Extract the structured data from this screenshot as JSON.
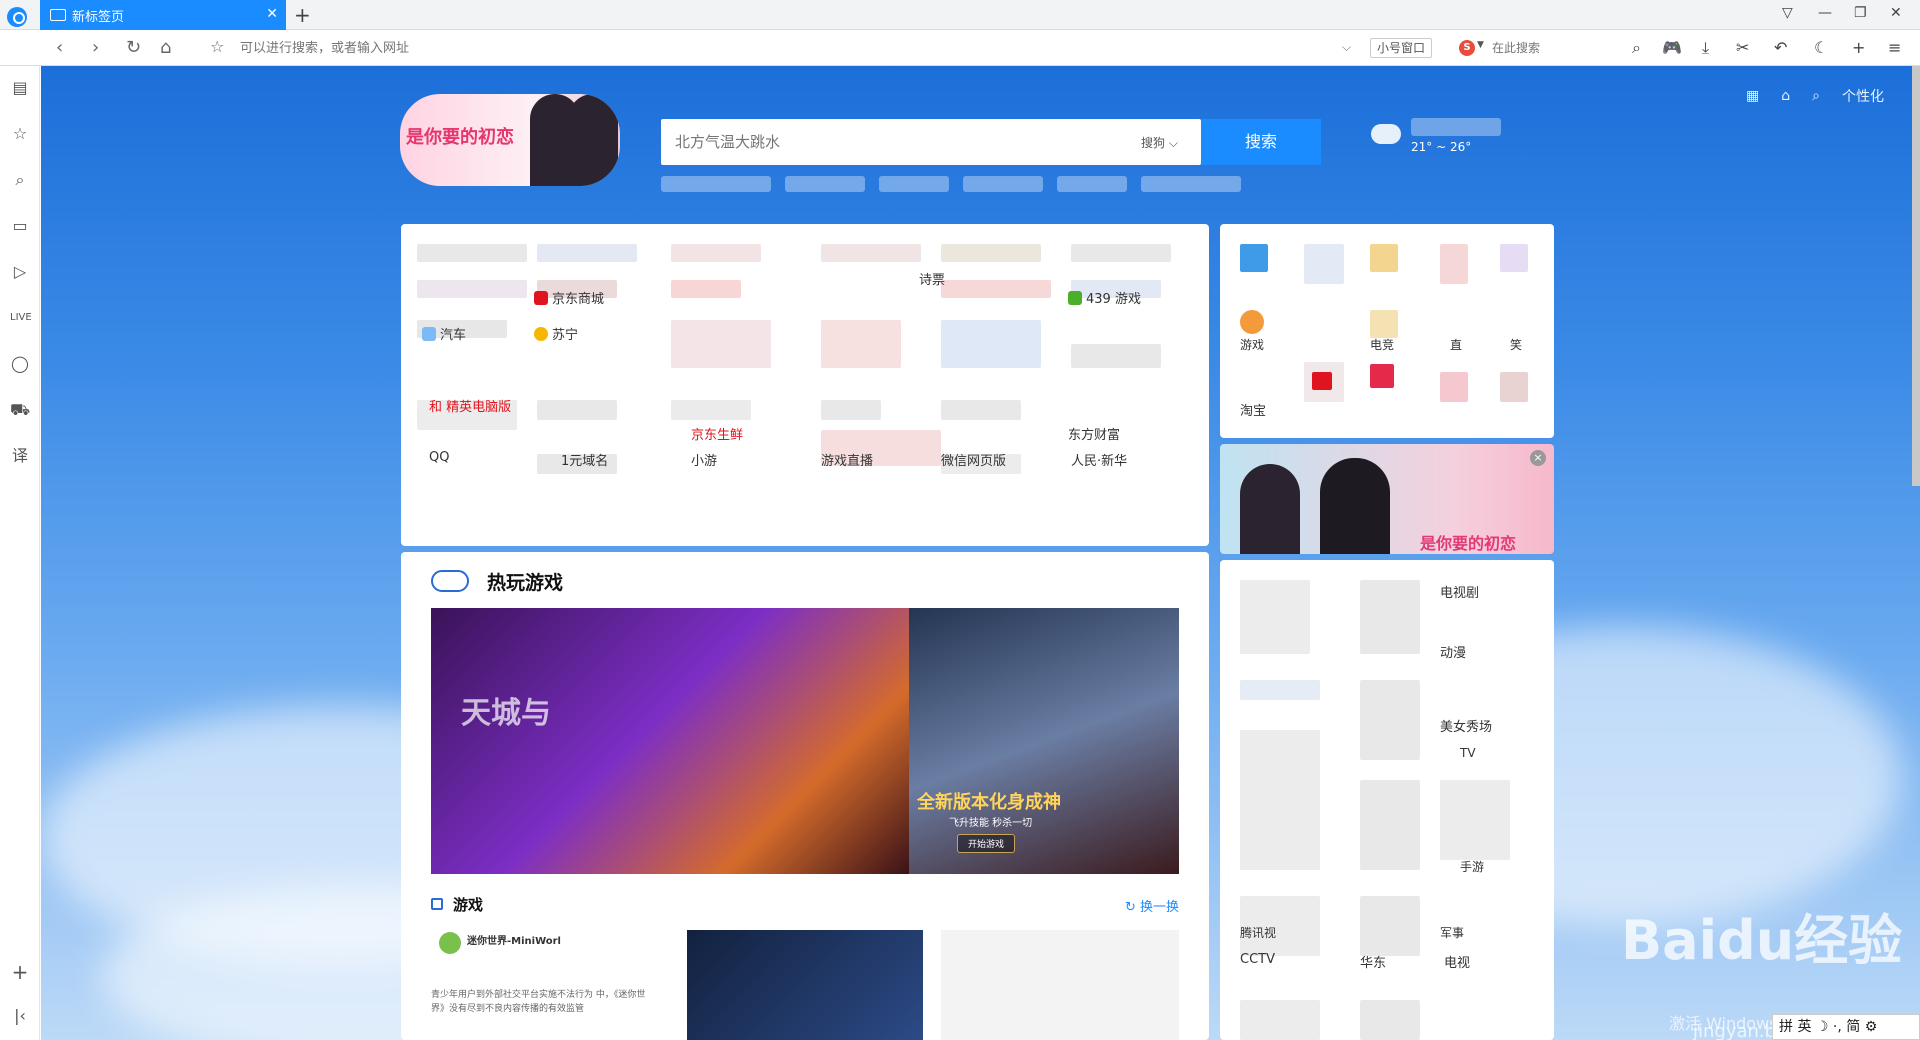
{
  "tabs": [
    {
      "label": "新标签页"
    }
  ],
  "window_controls": [
    "pin-icon",
    "minimize-icon",
    "restore-icon",
    "close-icon"
  ],
  "address_bar": {
    "placeholder": "可以进行搜索，或者输入网址"
  },
  "toolbar": {
    "small_window_label": "小号窗口",
    "engine_letter": "S",
    "search_placeholder": "在此搜索"
  },
  "sidebar_icons": [
    "news-icon",
    "favorites-star-icon",
    "search-icon",
    "reading-icon",
    "video-icon",
    "live-icon",
    "chat-icon",
    "shopping-cart-icon",
    "translate-icon",
    "add-icon",
    "collapse-icon"
  ],
  "page": {
    "personalize_label": "个性化",
    "banner_text": "是你要的初恋",
    "search": {
      "placeholder": "北方气温大跳水",
      "engine": "搜狗",
      "button_label": "搜索"
    },
    "weather": {
      "temp": "21° ~ 26°"
    }
  },
  "nav_links": {
    "r1": [
      "",
      "",
      "",
      "",
      "",
      ""
    ],
    "r2": [
      "汽车",
      "京东商城",
      "苏宁",
      "439",
      "游戏"
    ],
    "r3": [
      "和",
      "精英电脑版",
      "京东生鲜",
      "东方财富"
    ],
    "r4": [
      "QQ",
      "1元域名",
      "小游",
      "游戏直播",
      "微信网页版",
      "人民·新华"
    ],
    "r5": [
      "诗票"
    ]
  },
  "apps": {
    "labels": [
      "游戏",
      "电竞",
      "直",
      "笑",
      "淘宝"
    ]
  },
  "ad": {
    "text": "是你要的初恋",
    "close_glyph": "×"
  },
  "video": {
    "labels": [
      "电视剧",
      "动漫",
      "美女秀场",
      "TV",
      "手游",
      "腾讯视",
      "军事",
      "CCTV",
      "华东",
      "电视"
    ]
  },
  "games": {
    "title": "热玩游戏",
    "banner_left_text": "天城与",
    "banner_right_title": "全新版本化身成神",
    "banner_right_sub": "飞升技能 秒杀一切",
    "banner_right_btn": "开始游戏"
  },
  "news": {
    "title": "游戏",
    "refresh_label": "换一换",
    "item_title": "迷你世界-MiniWorl",
    "item_text": "青少年用户到外部社交平台实施不法行为\n中，《迷你世界》没有尽到不良内容传播的有效监管"
  },
  "watermark": {
    "brand": "Baidu经验",
    "sub": "jingyan.baidu.com",
    "activate": "激活 Windows"
  },
  "ime": {
    "text": "拼 英 ☽ ·, 简 ⚙"
  }
}
